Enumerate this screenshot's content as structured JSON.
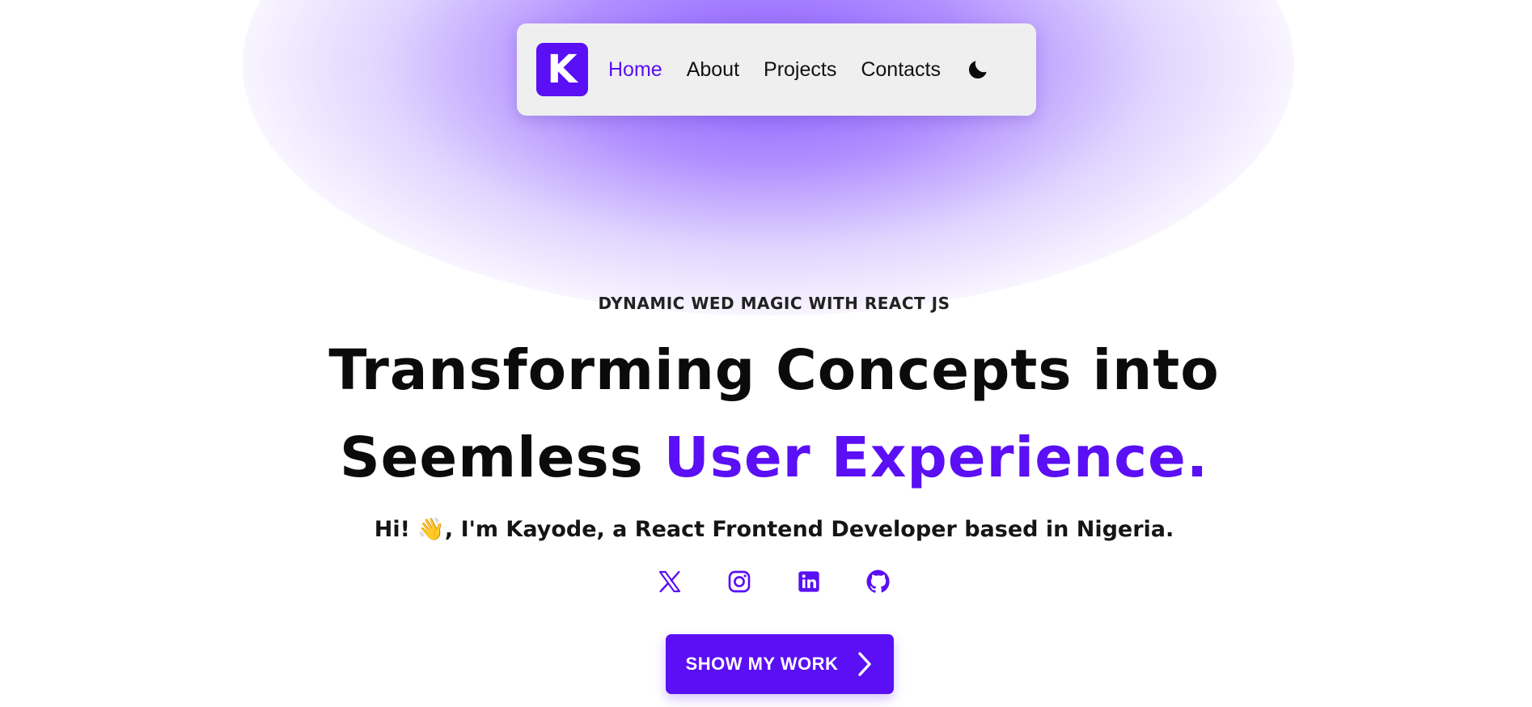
{
  "nav": {
    "logo_letter": "K",
    "links": [
      {
        "label": "Home",
        "active": true
      },
      {
        "label": "About",
        "active": false
      },
      {
        "label": "Projects",
        "active": false
      },
      {
        "label": "Contacts",
        "active": false
      }
    ],
    "theme_toggle_icon": "moon-icon"
  },
  "hero": {
    "eyebrow": "DYNAMIC WED MAGIC WITH REACT JS",
    "headline_line1": "Transforming Concepts into",
    "headline_line2_plain": "Seemless ",
    "headline_line2_accent": "User Experience.",
    "intro_prefix": "Hi! ",
    "intro_emoji": "👋",
    "intro_suffix": ", I'm Kayode, a React Frontend Developer based in Nigeria.",
    "socials": [
      {
        "icon": "x-twitter-icon"
      },
      {
        "icon": "instagram-icon"
      },
      {
        "icon": "linkedin-icon"
      },
      {
        "icon": "github-icon"
      }
    ],
    "cta_label": "SHOW MY WORK",
    "cta_icon": "chevron-right-icon"
  },
  "colors": {
    "accent": "#5a0ff5",
    "glow": "#8654ff",
    "nav_bg": "#efefef",
    "text": "#0b0b0b"
  }
}
